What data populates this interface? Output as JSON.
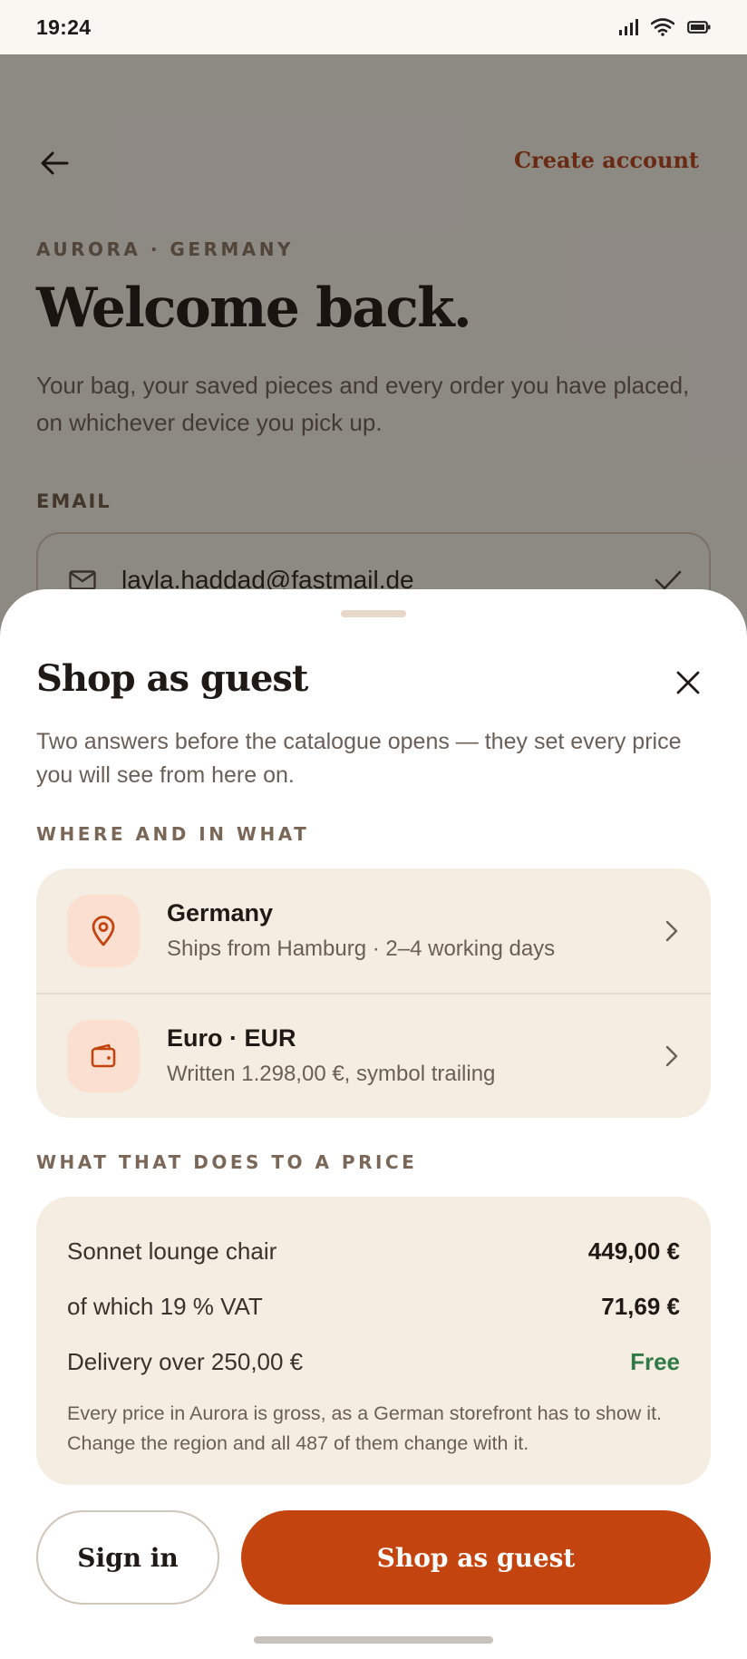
{
  "status_bar": {
    "time": "19:24"
  },
  "background": {
    "back_icon": "arrow-left-icon",
    "create_account_label": "Create account",
    "eyebrow": "AURORA · GERMANY",
    "title": "Welcome back.",
    "description": "Your bag, your saved pieces and every order you have placed, on whichever device you pick up.",
    "email": {
      "label": "EMAIL",
      "value": "layla.haddad@fastmail.de",
      "icon": "mail-icon",
      "status_icon": "check-icon"
    }
  },
  "sheet": {
    "title": "Shop as guest",
    "description": "Two answers before the catalogue opens — they set every price you will see from here on.",
    "section_where": "WHERE AND IN WHAT",
    "options": [
      {
        "title": "Germany",
        "subtitle": "Ships from Hamburg · 2–4 working days",
        "icon": "location-pin-icon"
      },
      {
        "title": "Euro · EUR",
        "subtitle": "Written 1.298,00 €, symbol trailing",
        "icon": "wallet-icon"
      }
    ],
    "section_price": "WHAT THAT DOES TO A PRICE",
    "price": {
      "rows": [
        {
          "label": "Sonnet lounge chair",
          "value": "449,00 €"
        },
        {
          "label": "of which 19 % VAT",
          "value": "71,69 €"
        },
        {
          "label": "Delivery over 250,00 €",
          "value": "Free"
        }
      ],
      "note": "Every price in Aurora is gross, as a German storefront has to show it. Change the region and all 487 of them change with it."
    },
    "sign_in_label": "Sign in",
    "guest_label": "Shop as guest"
  },
  "colors": {
    "accent": "#c4440f",
    "link": "#b5401b",
    "card": "#f5ede2",
    "free": "#2f7a46",
    "icon_tile": "#fbdfd1"
  }
}
